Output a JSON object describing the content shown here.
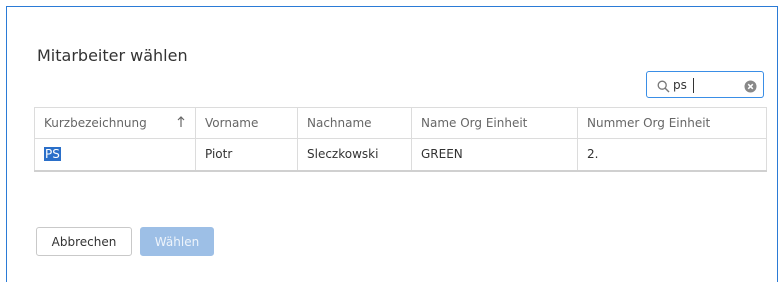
{
  "dialog": {
    "title": "Mitarbeiter wählen"
  },
  "search": {
    "value": "ps",
    "icon": "search-icon",
    "clear_icon": "clear-icon"
  },
  "table": {
    "columns": [
      {
        "label": "Kurzbezeichnung",
        "sort": "ascending"
      },
      {
        "label": "Vorname"
      },
      {
        "label": "Nachname"
      },
      {
        "label": "Name Org Einheit"
      },
      {
        "label": "Nummer Org Einheit"
      }
    ],
    "rows": [
      [
        "PS",
        "Piotr",
        "Sleczkowski",
        "GREEN",
        "2."
      ]
    ],
    "sort_icon": "sort-ascending-icon"
  },
  "buttons": {
    "cancel_label": "Abbrechen",
    "choose_label": "Wählen"
  },
  "colors": {
    "accent": "#2b7bd6",
    "selection": "#2a6fc9",
    "disabled_button": "#9dbfe6"
  }
}
